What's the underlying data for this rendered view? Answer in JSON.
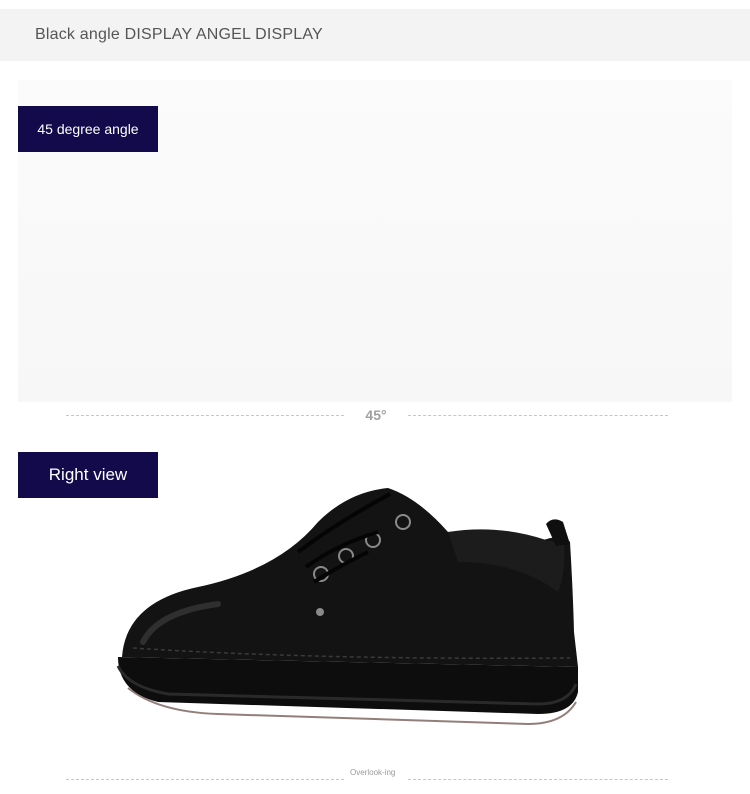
{
  "header": {
    "title": "Black angle DISPLAY ANGEL DISPLAY"
  },
  "views": [
    {
      "label": "45 degree angle",
      "divider_label": "45°"
    },
    {
      "label": "Right view",
      "divider_label": "Overlook-ing"
    }
  ],
  "colors": {
    "label_bg": "#120a4a",
    "header_bg": "#f3f3f3",
    "shoe": "#111111"
  }
}
